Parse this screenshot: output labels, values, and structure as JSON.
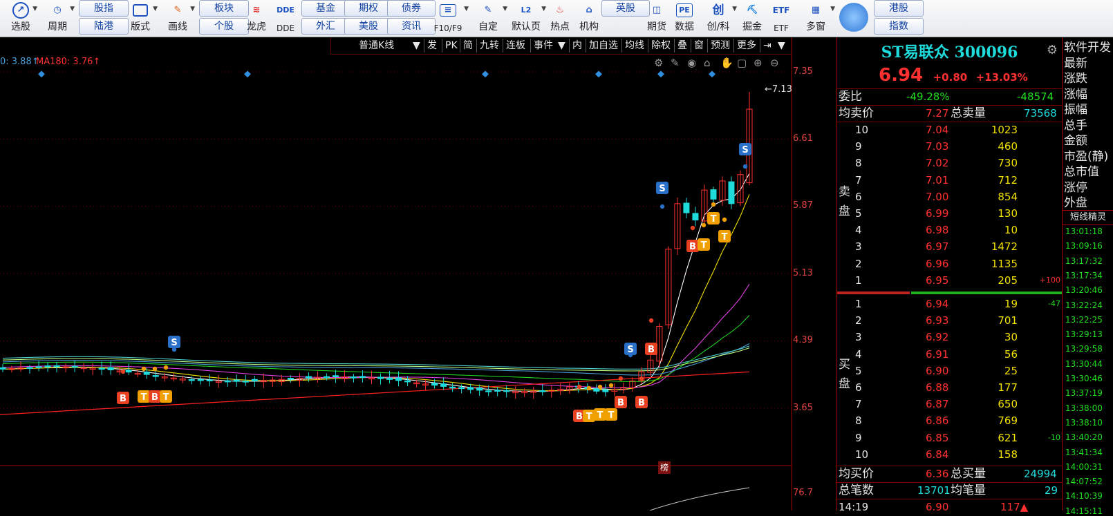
{
  "toolbar": {
    "items": [
      {
        "label": "选股",
        "icon": "trend-chart-icon"
      },
      {
        "label": "周期",
        "icon": "clock-icon"
      },
      {
        "label": "版式",
        "icon": "layout-icon"
      },
      {
        "label": "画线",
        "icon": "pen-icon"
      },
      {
        "label": "龙虎",
        "icon": "dragon-tiger-icon"
      },
      {
        "label": "DDE",
        "icon": "dde-icon"
      },
      {
        "label": "F10/F9",
        "icon": "f10-icon"
      },
      {
        "label": "自定",
        "icon": "custom-icon"
      },
      {
        "label": "默认页",
        "icon": "l2-icon"
      },
      {
        "label": "热点",
        "icon": "hot-icon"
      },
      {
        "label": "机构",
        "icon": "institution-icon"
      },
      {
        "label": "期货",
        "icon": "futures-icon"
      },
      {
        "label": "数据",
        "icon": "pe-icon"
      },
      {
        "label": "创/科",
        "icon": "chuang-icon"
      },
      {
        "label": "掘金",
        "icon": "gold-icon"
      },
      {
        "label": "ETF",
        "icon": "etf-icon"
      },
      {
        "label": "多窗",
        "icon": "multiwindow-icon"
      }
    ],
    "pills_top": [
      "股指",
      "板块",
      "基金",
      "期权",
      "债券",
      "英股",
      "港股"
    ],
    "pills_bottom": [
      "陆港",
      "个股",
      "外汇",
      "美股",
      "资讯",
      "指数"
    ],
    "icon_text": {
      "dde": "DDE",
      "pe": "PE",
      "chuang": "创",
      "etf": "ETF",
      "l2": "L2"
    }
  },
  "chart_menu": [
    "普通K线",
    "发",
    "PK",
    "简",
    "九转",
    "连板",
    "事件",
    "内",
    "加自选",
    "均线",
    "除权",
    "叠",
    "窗",
    "预测",
    "更多"
  ],
  "ma_labels": [
    {
      "text": "0: 3.88↑",
      "color": "#4a9ed8"
    },
    {
      "text": "MA180: 3.76↑",
      "color": "#ff3030"
    }
  ],
  "price_axis": [
    "7.35",
    "6.61",
    "5.87",
    "5.13",
    "4.39",
    "3.65"
  ],
  "volume_axis": "76.7",
  "high_marker": "7.13",
  "bang_badge": "榜",
  "chart_data": {
    "type": "candlestick",
    "ylim": [
      3.3,
      7.5
    ],
    "y_ticks": [
      7.35,
      6.61,
      5.87,
      5.13,
      4.39,
      3.65
    ],
    "high_label": 7.13
  },
  "quote": {
    "title": "ST易联众 300096",
    "price": "6.94",
    "change": "+0.80",
    "change_pct": "+13.03%",
    "weibi_label": "委比",
    "weibi_pct": "-49.28%",
    "weibi_val": "-48574",
    "avg_sell_label": "均卖价",
    "avg_sell": "7.27",
    "total_sell_label": "总卖量",
    "total_sell": "73568",
    "sell_tag": "卖盘",
    "buy_tag": "买盘",
    "asks": [
      {
        "lvl": "10",
        "price": "7.04",
        "vol": "1023",
        "chg": ""
      },
      {
        "lvl": "9",
        "price": "7.03",
        "vol": "460",
        "chg": ""
      },
      {
        "lvl": "8",
        "price": "7.02",
        "vol": "730",
        "chg": ""
      },
      {
        "lvl": "7",
        "price": "7.01",
        "vol": "712",
        "chg": ""
      },
      {
        "lvl": "6",
        "price": "7.00",
        "vol": "854",
        "chg": ""
      },
      {
        "lvl": "5",
        "price": "6.99",
        "vol": "130",
        "chg": ""
      },
      {
        "lvl": "4",
        "price": "6.98",
        "vol": "10",
        "chg": ""
      },
      {
        "lvl": "3",
        "price": "6.97",
        "vol": "1472",
        "chg": ""
      },
      {
        "lvl": "2",
        "price": "6.96",
        "vol": "1135",
        "chg": ""
      },
      {
        "lvl": "1",
        "price": "6.95",
        "vol": "205",
        "chg": "+100"
      }
    ],
    "bids": [
      {
        "lvl": "1",
        "price": "6.94",
        "vol": "19",
        "chg": "-47"
      },
      {
        "lvl": "2",
        "price": "6.93",
        "vol": "701",
        "chg": ""
      },
      {
        "lvl": "3",
        "price": "6.92",
        "vol": "30",
        "chg": ""
      },
      {
        "lvl": "4",
        "price": "6.91",
        "vol": "56",
        "chg": ""
      },
      {
        "lvl": "5",
        "price": "6.90",
        "vol": "25",
        "chg": ""
      },
      {
        "lvl": "6",
        "price": "6.88",
        "vol": "177",
        "chg": ""
      },
      {
        "lvl": "7",
        "price": "6.87",
        "vol": "650",
        "chg": ""
      },
      {
        "lvl": "8",
        "price": "6.86",
        "vol": "769",
        "chg": ""
      },
      {
        "lvl": "9",
        "price": "6.85",
        "vol": "621",
        "chg": "-10"
      },
      {
        "lvl": "10",
        "price": "6.84",
        "vol": "158",
        "chg": ""
      }
    ],
    "avg_buy_label": "均买价",
    "avg_buy": "6.36",
    "total_buy_label": "总买量",
    "total_buy": "24994",
    "total_trades_label": "总笔数",
    "total_trades": "13701",
    "avg_trade_label": "均笔量",
    "avg_trade": "29",
    "last_tick": {
      "time": "14:19",
      "price": "6.90",
      "vol": "117▲"
    }
  },
  "right_col": {
    "items": [
      "软件开发",
      "最新",
      "涨跌",
      "涨幅",
      "振幅",
      "总手",
      "金额",
      "市盈(静)",
      "总市值",
      "涨停",
      "外盘"
    ],
    "section": "短线精灵",
    "times": [
      "13:01:18",
      "13:09:16",
      "13:17:32",
      "13:17:34",
      "13:20:46",
      "13:22:24",
      "13:22:25",
      "13:29:13",
      "13:29:58",
      "13:30:44",
      "13:30:46",
      "13:37:19",
      "13:38:00",
      "13:38:10",
      "13:40:20",
      "13:41:34",
      "14:00:31",
      "14:07:52",
      "14:10:39",
      "14:15:11"
    ]
  },
  "colors": {
    "up": "#ff3030",
    "down": "#1edcdc",
    "accent": "#1edcdc"
  }
}
